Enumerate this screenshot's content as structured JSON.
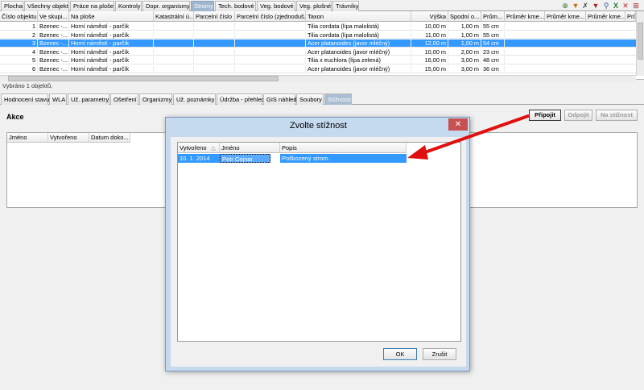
{
  "top_tabs": [
    "Plocha",
    "Všechny objekty",
    "Práce na ploše",
    "Kontroly",
    "Dopr. organismy",
    "Stromy",
    "Tech. bodové",
    "Veg. bodové",
    "Veg. plošné",
    "Trávníky"
  ],
  "toolbar_icons": [
    "zoom-icon",
    "filter-icon",
    "clear-filter-icon",
    "filter-remove-icon",
    "search-icon",
    "excel-icon",
    "close-icon",
    "grid-settings-icon"
  ],
  "grid": {
    "columns": [
      "Číslo objektu",
      "Ve skupi...",
      "Na ploše",
      "Katastrální ú...",
      "Parcelní číslo",
      "Parcelní číslo (zjednoduš...",
      "Taxon",
      "Výška",
      "Spodní o...",
      "Prům...",
      "Průměr kme...",
      "Průměr kme...",
      "Průměr kme...",
      "Prů"
    ],
    "rows": [
      [
        "1",
        "Bzenec -...",
        "Horní náměstí - parčík",
        "",
        "",
        "",
        "Tilia cordata (lípa malolistá)",
        "10,00 m",
        "1,00 m",
        "55 cm"
      ],
      [
        "2",
        "Bzenec -...",
        "Horní náměstí - parčík",
        "",
        "",
        "",
        "Tilia cordata (lípa malolistá)",
        "11,00 m",
        "1,00 m",
        "55 cm"
      ],
      [
        "3",
        "Bzenec -...",
        "Horní náměstí - parčík",
        "",
        "",
        "",
        "Acer platanoides (javor mléčný)",
        "12,00 m",
        "1,00 m",
        "54 cm"
      ],
      [
        "4",
        "Bzenec -...",
        "Horní náměstí - parčík",
        "",
        "",
        "",
        "Acer platanoides (javor mléčný)",
        "10,00 m",
        "2,00 m",
        "23 cm"
      ],
      [
        "5",
        "Bzenec -...",
        "Horní náměstí - parčík",
        "",
        "",
        "",
        "Tilia x euchlora (lípa zelená)",
        "16,00 m",
        "3,00 m",
        "48 cm"
      ],
      [
        "6",
        "Bzenec -...",
        "Horní náměstí - parčík",
        "",
        "",
        "",
        "Acer platanoides (javor mléčný)",
        "15,00 m",
        "3,00 m",
        "36 cm"
      ]
    ],
    "selected_row": 2
  },
  "status": "Vybráno 1 objektů.",
  "bottom_tabs": [
    "Hodnocení stavu",
    "WLA",
    "Už. parametry",
    "Ošetření",
    "Organizmy",
    "Už. poznámky",
    "Údržba - přehled",
    "GIS náhled",
    "Soubory",
    "Stížnosti"
  ],
  "panel": {
    "title": "Akce",
    "btn_attach": "Připojit",
    "btn_detach": "Odpojit",
    "btn_to_complaint": "Na stížnost",
    "list_columns": [
      "Jméno",
      "Vytvořeno",
      "Datum doko..."
    ]
  },
  "dialog": {
    "title": "Zvolte stížnost",
    "close": "✕",
    "columns": [
      "Vytvořeno",
      "Jméno",
      "Popis"
    ],
    "sort_indicator": "△",
    "row": {
      "created": "10. 1. 2014",
      "name": "Petr Cejnar",
      "description": "Poškozený strom."
    },
    "ok": "OK",
    "cancel": "Zrušit"
  },
  "colors": {
    "selection": "#3399ff",
    "arrow": "#e01010",
    "active_tab": "#9fb6cf",
    "dialog_frame": "#c5d9ef"
  }
}
